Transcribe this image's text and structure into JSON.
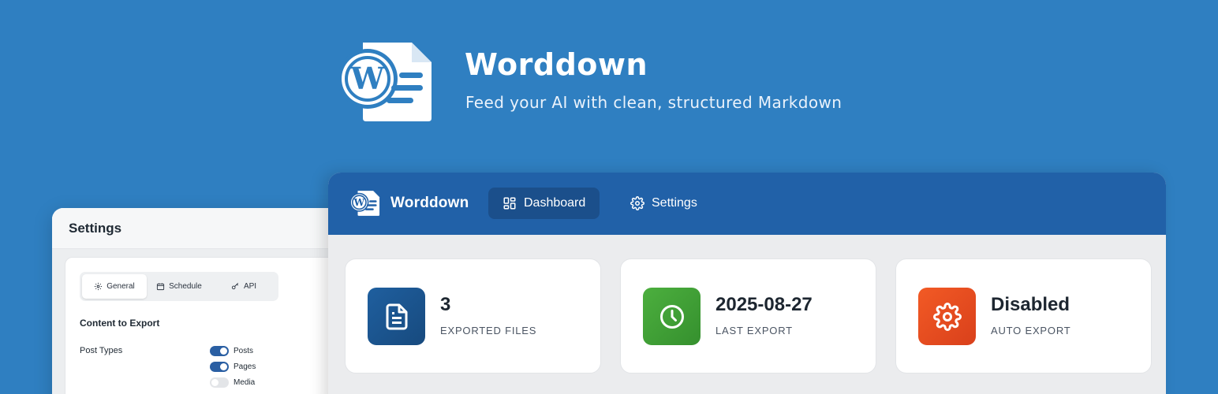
{
  "hero": {
    "title": "Worddown",
    "subtitle": "Feed your AI with clean, structured Markdown",
    "logo_icon": "wordpress-document-icon"
  },
  "settings_panel": {
    "title": "Settings",
    "tabs": [
      {
        "label": "General",
        "icon": "gear-icon",
        "active": true
      },
      {
        "label": "Schedule",
        "icon": "calendar-icon",
        "active": false
      },
      {
        "label": "API",
        "icon": "key-icon",
        "active": false
      }
    ],
    "section_title": "Content to Export",
    "post_types_label": "Post Types",
    "post_types": [
      {
        "label": "Posts",
        "enabled": true
      },
      {
        "label": "Pages",
        "enabled": true
      },
      {
        "label": "Media",
        "enabled": false
      }
    ]
  },
  "dashboard": {
    "brand": "Worddown",
    "nav": [
      {
        "label": "Dashboard",
        "icon": "grid-icon",
        "active": true
      },
      {
        "label": "Settings",
        "icon": "gear-icon",
        "active": false
      }
    ],
    "stats": [
      {
        "value": "3",
        "label": "EXPORTED FILES",
        "icon": "document-icon",
        "color": "#1d5a99"
      },
      {
        "value": "2025-08-27",
        "label": "LAST EXPORT",
        "icon": "clock-icon",
        "color": "#3f9e37"
      },
      {
        "value": "Disabled",
        "label": "AUTO EXPORT",
        "icon": "gear-icon",
        "color": "#e94a1f"
      }
    ]
  },
  "colors": {
    "background": "#2f7fc1",
    "header": "#2161a8",
    "active_nav": "#1b4f8b"
  }
}
